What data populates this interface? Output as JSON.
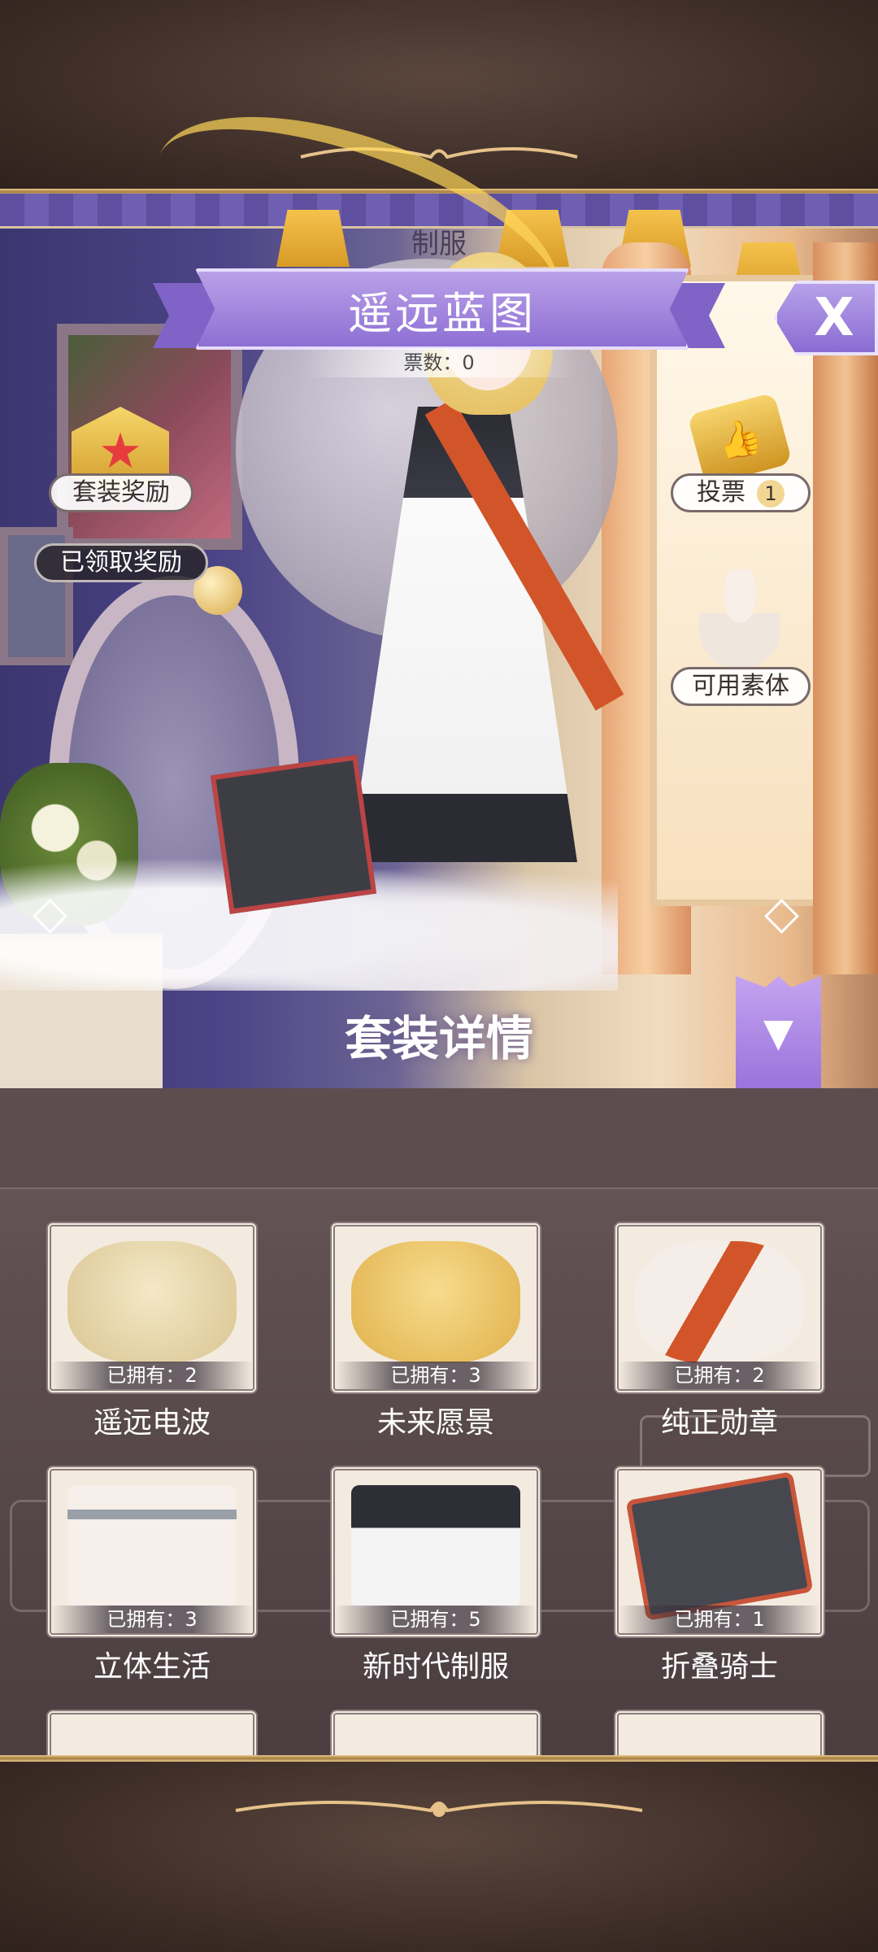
{
  "screen": {
    "category": "制服",
    "suit_name": "遥远蓝图",
    "votes_label": "票数：0",
    "close_label": "X"
  },
  "left_actions": {
    "suit_reward": "套装奖励",
    "claimed_reward": "已领取奖励"
  },
  "right_actions": {
    "vote_label": "投票",
    "vote_count": "1",
    "available_body": "可用素体"
  },
  "suit_detail_label": "套装详情",
  "items": [
    {
      "name": "遥远电波",
      "owned": "已拥有：2",
      "color": "#e9dcb8"
    },
    {
      "name": "未来愿景",
      "owned": "已拥有：3",
      "color": "#f0cf7a"
    },
    {
      "name": "纯正勋章",
      "owned": "已拥有：2",
      "color": "#f2e6dc"
    },
    {
      "name": "立体生活",
      "owned": "已拥有：3",
      "color": "#f4ece6"
    },
    {
      "name": "新时代制服",
      "owned": "已拥有：5",
      "color": "#3a3a44"
    },
    {
      "name": "折叠骑士",
      "owned": "已拥有：1",
      "color": "#4a4a52"
    }
  ],
  "colors": {
    "accent_purple": "#8d6fd4",
    "gold": "#d09a28"
  }
}
